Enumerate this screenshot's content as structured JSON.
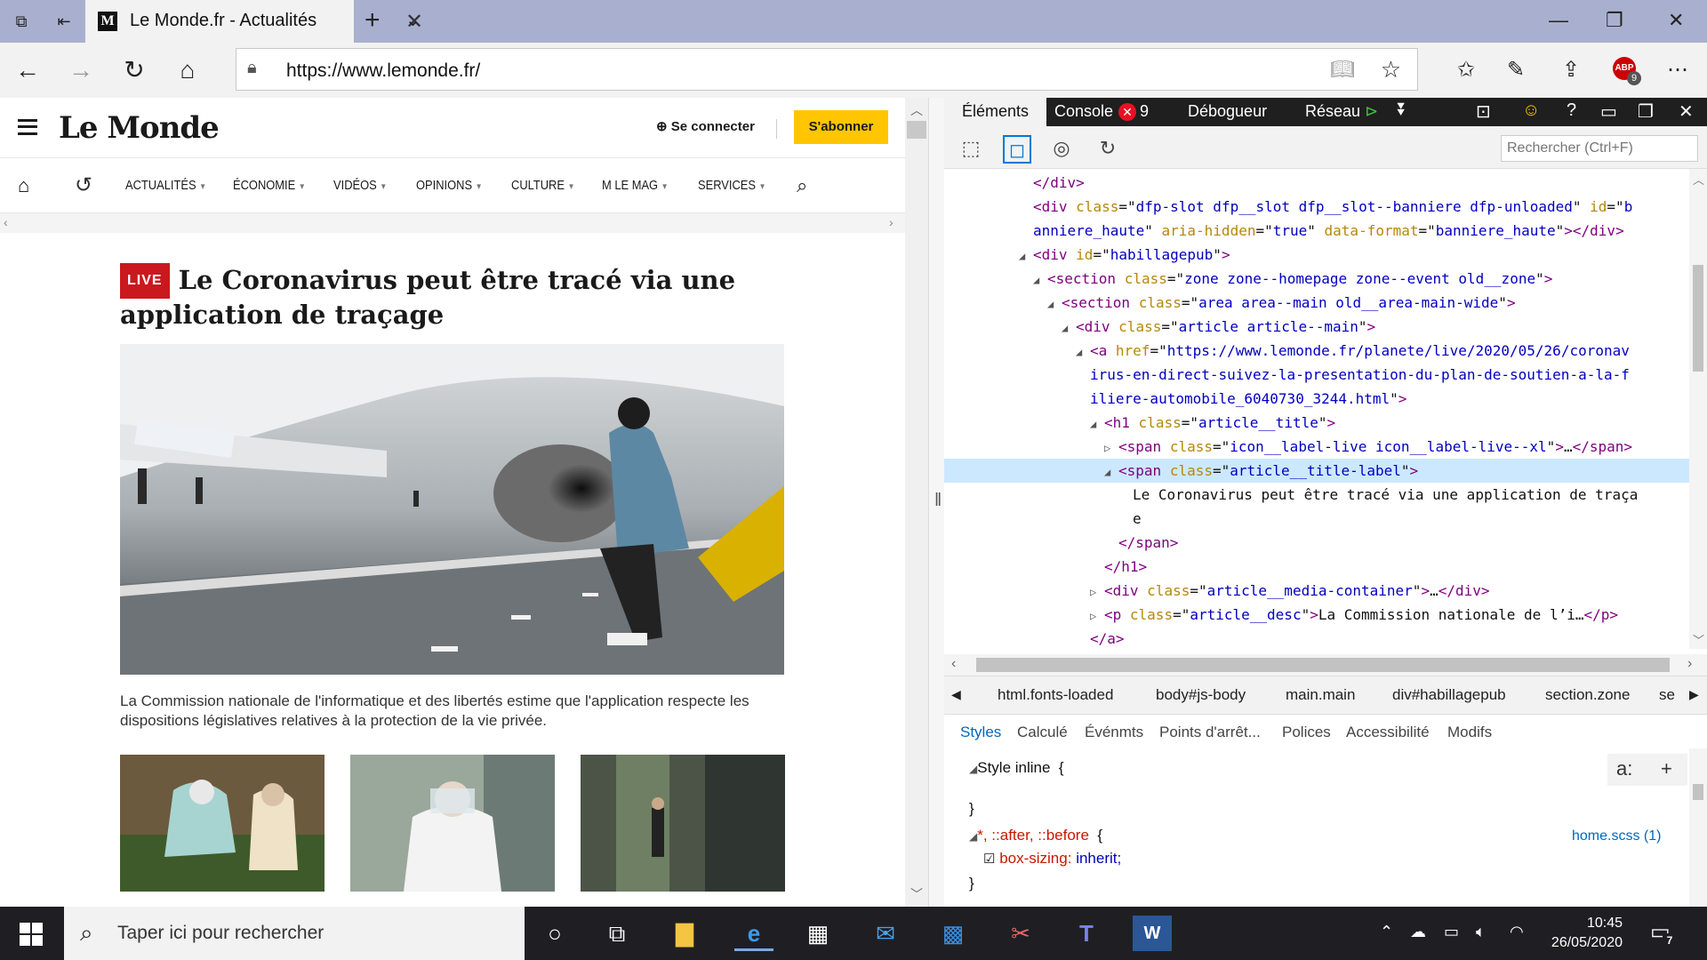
{
  "browser": {
    "tab_title": "Le Monde.fr - Actualités",
    "favicon_text": "M",
    "url": "https://www.lemonde.fr/",
    "adblock_count": "9",
    "abp_text": "ABP"
  },
  "site": {
    "logo": "Le Monde",
    "login": "Se connecter",
    "subscribe": "S'abonner",
    "nav": [
      "ACTUALITÉS",
      "ÉCONOMIE",
      "VIDÉOS",
      "OPINIONS",
      "CULTURE",
      "M LE MAG",
      "SERVICES"
    ],
    "live_label": "LIVE",
    "headline": "Le Coronavirus peut être tracé via une application de traçage",
    "caption": "La Commission nationale de l'informatique et des libertés estime que l'application respecte les dispositions législatives relatives à la protection de la vie privée."
  },
  "devtools": {
    "tabs": {
      "elements": "Éléments",
      "console": "Console",
      "console_errors": "9",
      "debugger": "Débogueur",
      "network": "Réseau"
    },
    "search_placeholder": "Rechercher (Ctrl+F)",
    "dom_lines": [
      {
        "indent": 6,
        "tw": "",
        "html": "<span class=\"tag\">&lt;/div&gt;</span>"
      },
      {
        "indent": 6,
        "tw": "",
        "html": "<span class=\"tag\">&lt;div</span> <span class=\"an\">class</span>=\"<span class=\"av\">dfp-slot dfp__slot dfp__slot--banniere dfp-unloaded</span>\" <span class=\"an\">id</span>=\"<span class=\"av\">b</span>"
      },
      {
        "indent": 6,
        "tw": "",
        "html": "<span class=\"av\">anniere_haute</span>\" <span class=\"an\">aria-hidden</span>=\"<span class=\"av\">true</span>\" <span class=\"an\">data-format</span>=\"<span class=\"av\">banniere_haute</span>\"<span class=\"tag\">&gt;&lt;/div&gt;</span>"
      },
      {
        "indent": 6,
        "tw": "◢",
        "html": "<span class=\"tag\">&lt;div</span> <span class=\"an\">id</span>=\"<span class=\"av\">habillagepub</span>\"<span class=\"tag\">&gt;</span>"
      },
      {
        "indent": 7,
        "tw": "◢",
        "html": "<span class=\"tag\">&lt;section</span> <span class=\"an\">class</span>=\"<span class=\"av\">zone zone--homepage zone--event old__zone</span>\"<span class=\"tag\">&gt;</span>"
      },
      {
        "indent": 8,
        "tw": "◢",
        "html": "<span class=\"tag\">&lt;section</span> <span class=\"an\">class</span>=\"<span class=\"av\">area area--main old__area-main-wide</span>\"<span class=\"tag\">&gt;</span>"
      },
      {
        "indent": 9,
        "tw": "◢",
        "html": "<span class=\"tag\">&lt;div</span> <span class=\"an\">class</span>=\"<span class=\"av\">article article--main</span>\"<span class=\"tag\">&gt;</span>"
      },
      {
        "indent": 10,
        "tw": "◢",
        "html": "<span class=\"tag\">&lt;a</span> <span class=\"an\">href</span>=\"<span class=\"av\">https://www.lemonde.fr/planete/live/2020/05/26/coronav</span>"
      },
      {
        "indent": 10,
        "tw": "",
        "html": "<span class=\"av\">irus-en-direct-suivez-la-presentation-du-plan-de-soutien-a-la-f</span>"
      },
      {
        "indent": 10,
        "tw": "",
        "html": "<span class=\"av\">iliere-automobile_6040730_3244.html</span>\"<span class=\"tag\">&gt;</span>"
      },
      {
        "indent": 11,
        "tw": "◢",
        "html": "<span class=\"tag\">&lt;h1</span> <span class=\"an\">class</span>=\"<span class=\"av\">article__title</span>\"<span class=\"tag\">&gt;</span>"
      },
      {
        "indent": 12,
        "tw": "▷",
        "html": "<span class=\"tag\">&lt;span</span> <span class=\"an\">class</span>=\"<span class=\"av\">icon__label-live icon__label-live--xl</span>\"<span class=\"tag\">&gt;</span>…<span class=\"tag\">&lt;/span&gt;</span>"
      },
      {
        "indent": 12,
        "tw": "◢",
        "html": "<span class=\"tag\">&lt;span</span> <span class=\"an\">class</span>=\"<span class=\"av\">article__title-label</span>\"<span class=\"tag\">&gt;</span>",
        "hl": true
      },
      {
        "indent": 13,
        "tw": "",
        "html": "Le Coronavirus peut être tracé via une application de traça"
      },
      {
        "indent": 13,
        "tw": "",
        "html": "e"
      },
      {
        "indent": 12,
        "tw": "",
        "html": "<span class=\"tag\">&lt;/span&gt;</span>"
      },
      {
        "indent": 11,
        "tw": "",
        "html": "<span class=\"tag\">&lt;/h1&gt;</span>"
      },
      {
        "indent": 11,
        "tw": "▷",
        "html": "<span class=\"tag\">&lt;div</span> <span class=\"an\">class</span>=\"<span class=\"av\">article__media-container</span>\"<span class=\"tag\">&gt;</span>…<span class=\"tag\">&lt;/div&gt;</span>"
      },
      {
        "indent": 11,
        "tw": "▷",
        "html": "<span class=\"tag\">&lt;p</span> <span class=\"an\">class</span>=\"<span class=\"av\">article__desc</span>\"<span class=\"tag\">&gt;</span>La Commission nationale de l’i…<span class=\"tag\">&lt;/p&gt;</span>"
      },
      {
        "indent": 10,
        "tw": "",
        "html": "<span class=\"tag\">&lt;/a&gt;</span>"
      }
    ],
    "breadcrumbs": [
      "html.fonts-loaded",
      "body#js-body",
      "main.main",
      "div#habillagepub",
      "section.zone",
      "se"
    ],
    "style_tabs": [
      "Styles",
      "Calculé",
      "Événmts",
      "Points d'arrêt...",
      "Polices",
      "Accessibilité",
      "Modifs"
    ],
    "styles": {
      "inline_label": "Style inline",
      "rule_selector": "*, ::after, ::before",
      "prop_name": "box-sizing:",
      "prop_value": "inherit;",
      "source": "home.scss (1)"
    }
  },
  "taskbar": {
    "search_placeholder": "Taper ici pour rechercher",
    "time": "10:45",
    "date": "26/05/2020",
    "notifications": "7"
  }
}
